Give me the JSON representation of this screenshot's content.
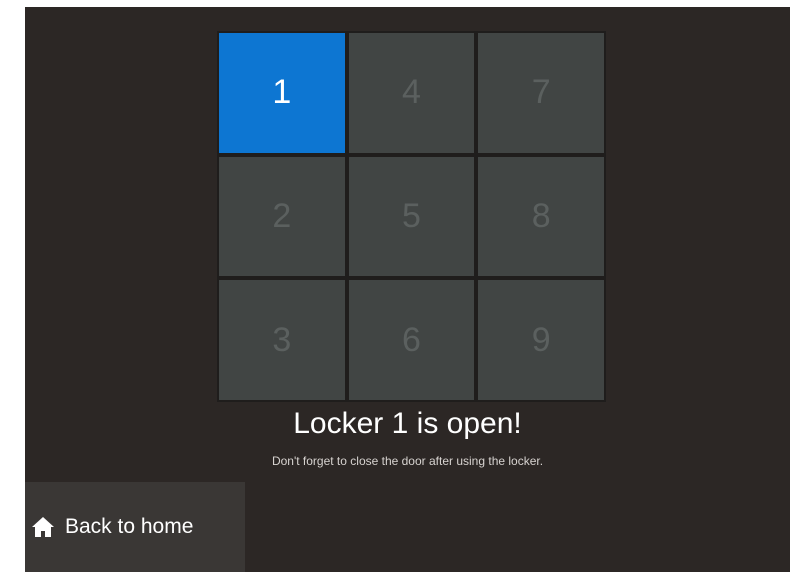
{
  "lockers": {
    "cells": [
      {
        "label": "1",
        "state": "open"
      },
      {
        "label": "4",
        "state": "closed"
      },
      {
        "label": "7",
        "state": "closed"
      },
      {
        "label": "2",
        "state": "closed"
      },
      {
        "label": "5",
        "state": "closed"
      },
      {
        "label": "8",
        "state": "closed"
      },
      {
        "label": "3",
        "state": "closed"
      },
      {
        "label": "6",
        "state": "closed"
      },
      {
        "label": "9",
        "state": "closed"
      }
    ]
  },
  "message": {
    "title": "Locker 1 is open!",
    "subtitle": "Don't forget to close the door after using the locker."
  },
  "nav": {
    "back_label": "Back to home",
    "back_icon": "home-icon"
  },
  "colors": {
    "open_accent": "#0d76d2",
    "locker_closed": "#414544",
    "background": "#2c2725"
  }
}
